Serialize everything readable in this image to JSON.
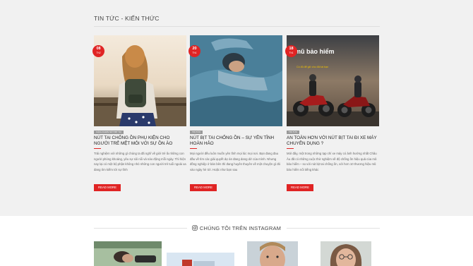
{
  "news": {
    "heading": "TIN TỨC - KIẾN THỨC",
    "read_more_label": "READ MORE",
    "cards": [
      {
        "day": "08",
        "month": "Th2",
        "tag": "CÁCH CHỌN NÚT BỊT TAI",
        "title": "NÚT TAI CHỐNG ỒN PHỤ KIỆN CHO NGƯỜI TRẺ MỆT MỎI VỚI SỰ ỒN ÀO",
        "excerpt": "Trải nghiệm với những gì chúng ta đã nghĩ về giới trẻ là những con người phóng khoáng, yêu sự sôi nổi và náo động mỗi ngày. Thì hiện nay lại có một bộ phận không nhỏ những con người trẻ tuổi ngoài xa đang tìm kiếm tới sự tĩnh"
      },
      {
        "day": "20",
        "month": "Th1",
        "tag": "TIN TỨC",
        "title": "NÚT BỊT TAI CHỐNG ỒN – SỰ YÊN TĨNH HOÀN HẢO",
        "excerpt": "Mọi người đều luôn muốn yên tĩnh mọi lúc mọi nơi. Bạn đang đau đầu về tìm các giải quyết dự án đang dang dở của mình. Nhưng đồng nghiệp ở bàn bên thì đang huyên thuyên về một chuyện gì đó vào ngày hè tới. Hoặc như bạn sau"
      },
      {
        "day": "18",
        "month": "Th1",
        "tag": "TIN TỨC",
        "title": "AN TOÀN HƠN VỚI NÚT BỊT TAI ĐI XE MÁY CHUYÊN DỤNG ?",
        "excerpt": "Mới đây, một trong những tạp chí xe máy có ảnh hưởng nhất Châu Âu đã có những cuộc thử nghiệm về độ chống ồn hiệu quả của mũ bảo hiểm – so với nút bịt tai chống ồn, với hơn 10 thương hiệu mũ bảo hiểm nổi tiếng khác",
        "image_text": "mũ bảo hiểm",
        "image_subtext": "Có đủ để giữ cho đôi tai bạn"
      }
    ]
  },
  "instagram": {
    "heading": "CHÚNG TÔI TRÊN INSTAGRAM"
  },
  "colors": {
    "accent": "#e02424",
    "background": "#f1f1f1"
  }
}
